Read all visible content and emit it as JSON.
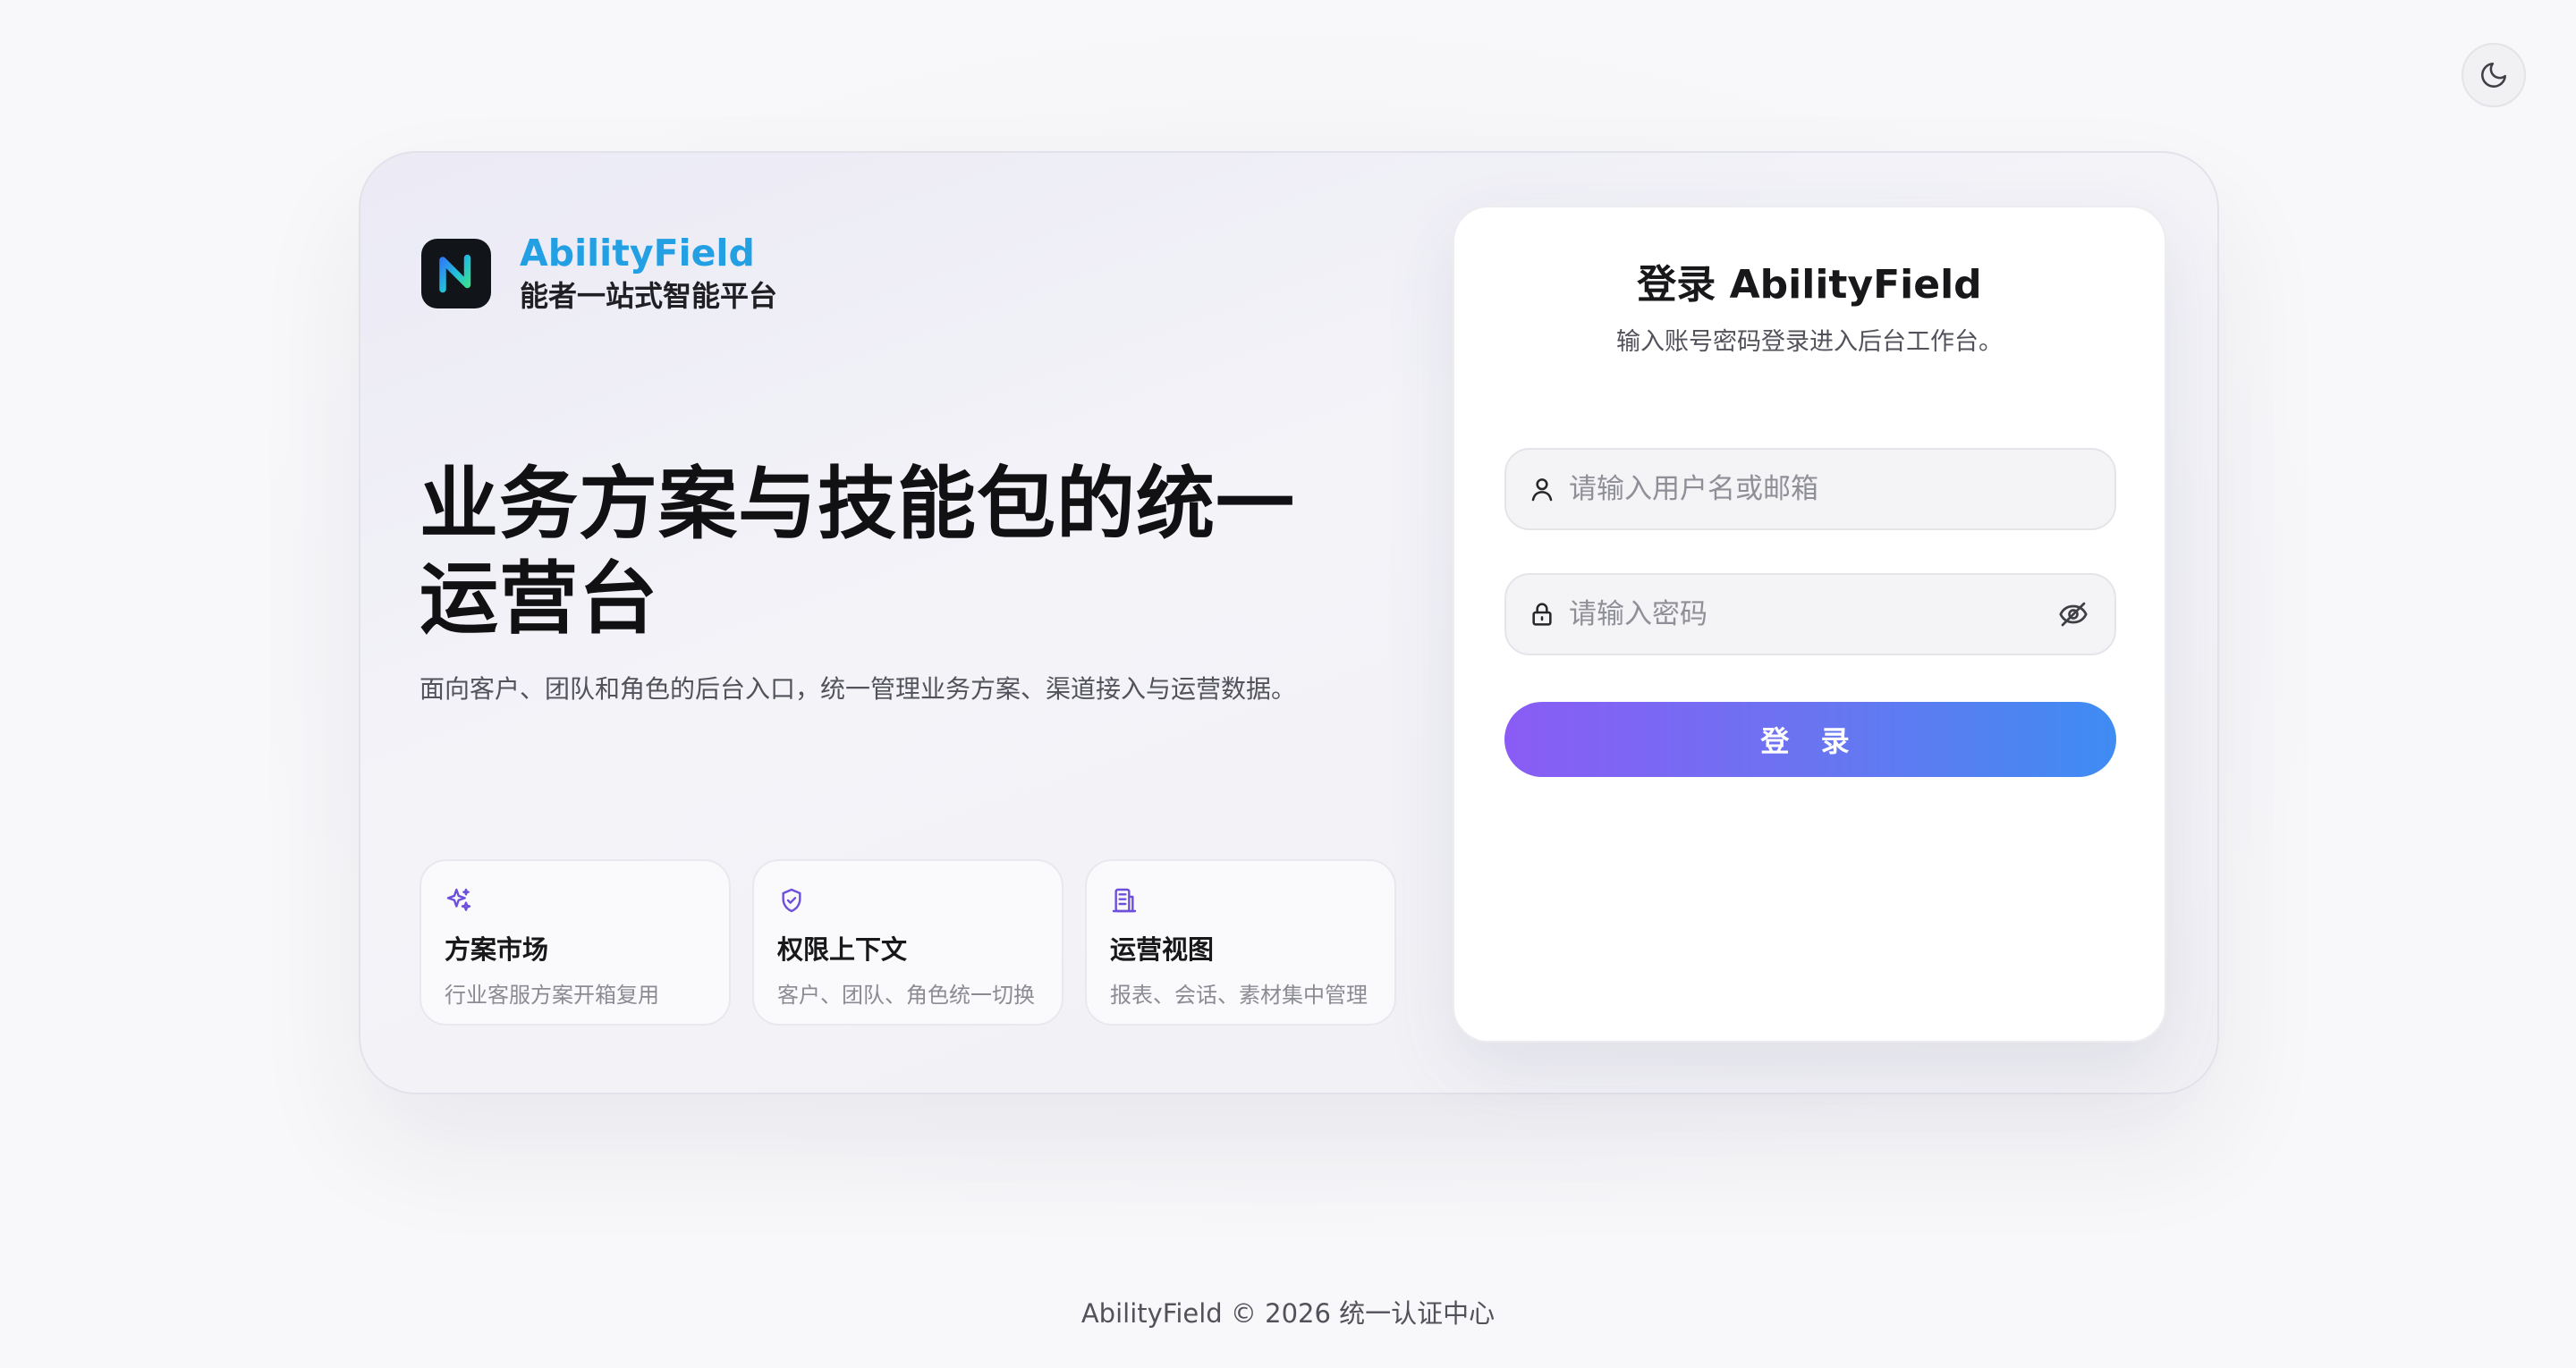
{
  "theme_toggle": {
    "icon": "moon-icon"
  },
  "brand": {
    "name": "AbilityField",
    "subtitle": "能者一站式智能平台",
    "logo_icon": "logo-icon"
  },
  "hero": {
    "title_line1": "业务方案与技能包的统一",
    "title_line2": "运营台",
    "subtitle": "面向客户、团队和角色的后台入口，统一管理业务方案、渠道接入与运营数据。"
  },
  "features": [
    {
      "icon": "sparkles-icon",
      "title": "方案市场",
      "desc": "行业客服方案开箱复用"
    },
    {
      "icon": "shield-check-icon",
      "title": "权限上下文",
      "desc": "客户、团队、角色统一切换"
    },
    {
      "icon": "building-icon",
      "title": "运营视图",
      "desc": "报表、会话、素材集中管理"
    }
  ],
  "login": {
    "title": "登录 AbilityField",
    "subtitle": "输入账号密码登录进入后台工作台。",
    "username_placeholder": "请输入用户名或邮箱",
    "username_value": "",
    "password_placeholder": "请输入密码",
    "password_value": "",
    "submit_label": "登 录"
  },
  "footer": {
    "text": "AbilityField © 2026 统一认证中心"
  },
  "colors": {
    "accent_brand": "#22a0e3",
    "button_gradient_start": "#8a5cf5",
    "button_gradient_end": "#3f8cf3",
    "feature_icon": "#6d4fdc"
  }
}
